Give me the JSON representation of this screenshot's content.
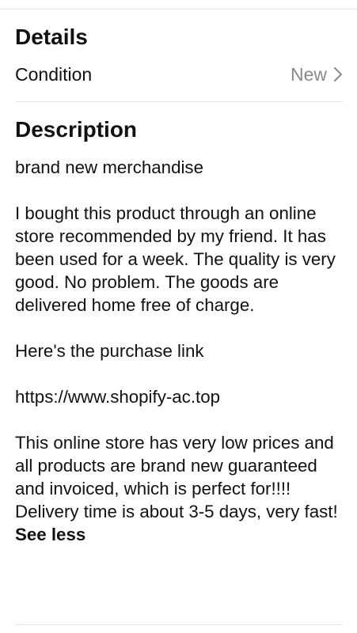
{
  "details": {
    "title": "Details",
    "condition_label": "Condition",
    "condition_value": "New"
  },
  "description": {
    "title": "Description",
    "paragraphs": [
      "brand new merchandise",
      "I bought this product through an online store recommended by my friend. It has been used for a week. The quality is very good. No problem. The goods are delivered home free of charge.",
      "Here's the purchase link",
      "https://www.shopify-ac.top",
      "This online store has very low prices and all products are brand new guaranteed and invoiced, which is perfect for!!!! Delivery time is about 3-5 days, very fast!"
    ],
    "see_less_label": "See less"
  },
  "icons": {
    "chevron": "chevron-right-icon"
  }
}
